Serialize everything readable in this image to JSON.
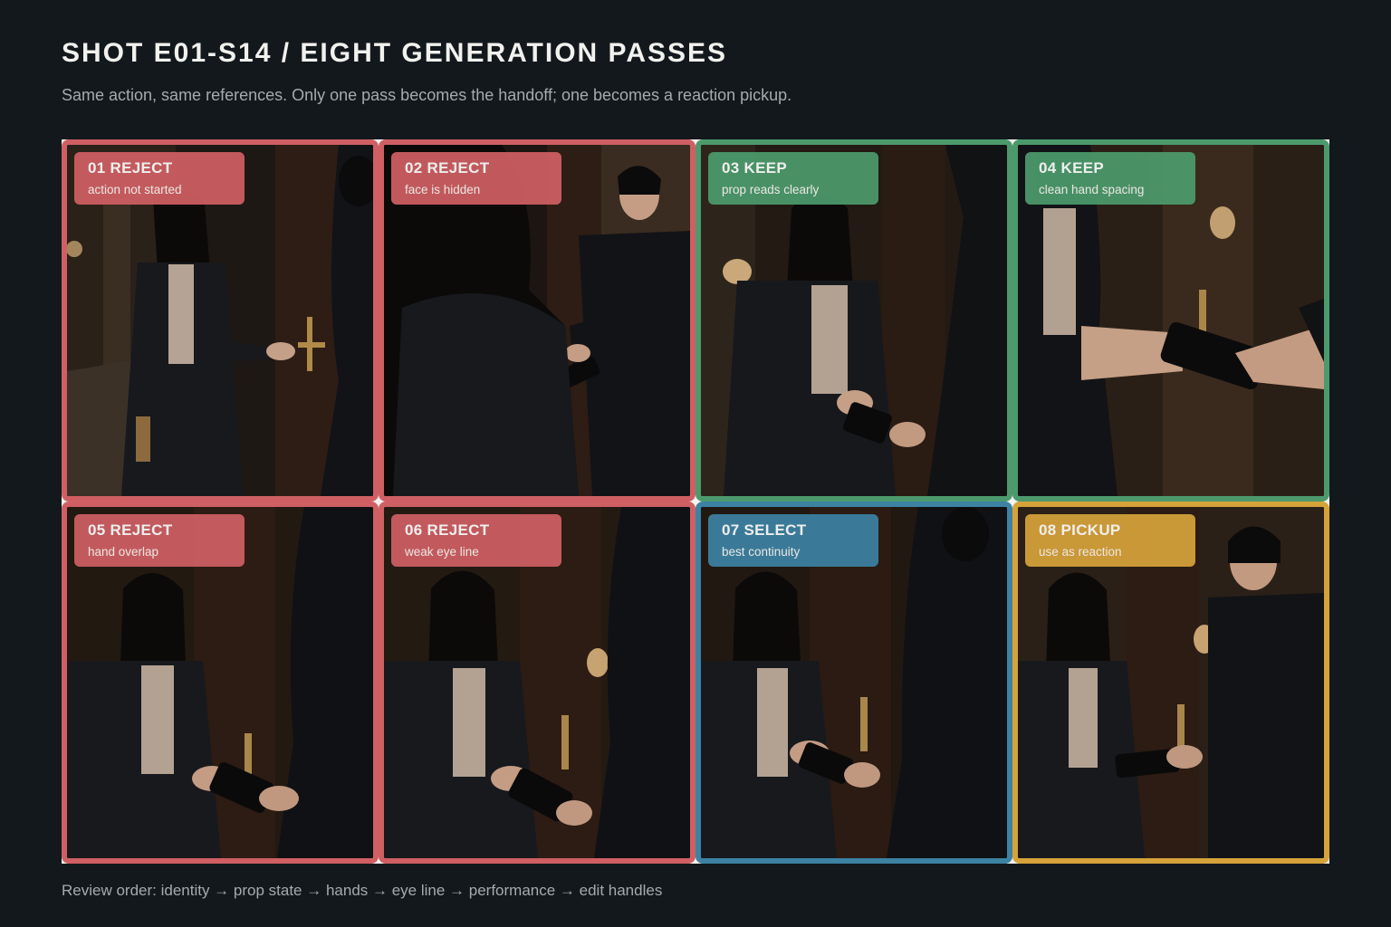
{
  "header": {
    "title": "SHOT E01-S14 / EIGHT GENERATION PASSES",
    "subtitle": "Same action, same references. Only one pass becomes the handoff; one becomes a reaction pickup."
  },
  "status_colors": {
    "reject": "#cf5f63",
    "keep": "#4c9a6c",
    "select": "#3c82a3",
    "pickup": "#d6a23a"
  },
  "passes": [
    {
      "label": "01 REJECT",
      "note": "action not started",
      "status": "reject"
    },
    {
      "label": "02 REJECT",
      "note": "face is hidden",
      "status": "reject"
    },
    {
      "label": "03 KEEP",
      "note": "prop reads clearly",
      "status": "keep"
    },
    {
      "label": "04 KEEP",
      "note": "clean hand spacing",
      "status": "keep"
    },
    {
      "label": "05 REJECT",
      "note": "hand overlap",
      "status": "reject"
    },
    {
      "label": "06 REJECT",
      "note": "weak eye line",
      "status": "reject"
    },
    {
      "label": "07 SELECT",
      "note": "best continuity",
      "status": "select"
    },
    {
      "label": "08 PICKUP",
      "note": "use as reaction",
      "status": "pickup"
    }
  ],
  "footer": {
    "review_order": "Review order: identity → prop state → hands → eye line → performance → edit handles"
  }
}
